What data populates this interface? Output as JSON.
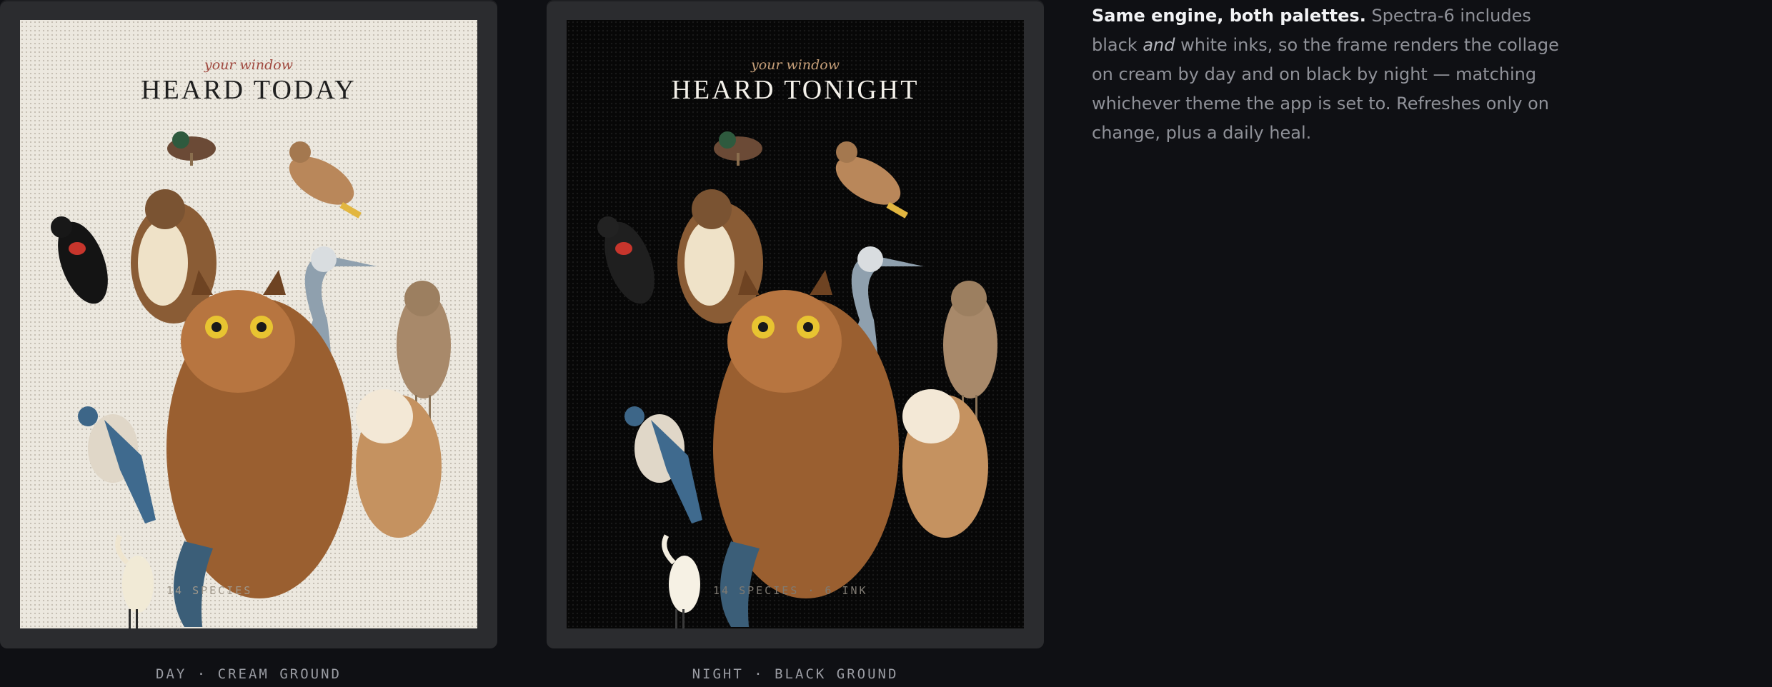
{
  "frames": [
    {
      "kicker": "your window",
      "headline": "HEARD TODAY",
      "footer": "14 SPECIES",
      "caption": "DAY · CREAM GROUND"
    },
    {
      "kicker": "your window",
      "headline": "HEARD TONIGHT",
      "footer": "14 SPECIES · 6 INK",
      "caption": "NIGHT · BLACK GROUND"
    }
  ],
  "description": {
    "lead": "Same engine, both palettes.",
    "part1": " Spectra-6 includes black ",
    "emph": "and",
    "part2": " white inks, so the frame renders the collage on cream by day and on black by night — matching whichever theme the app is set to. Refreshes only on change, plus a daily heal."
  },
  "colors": {
    "page_bg": "#0f1014",
    "frame_bg": "#2b2c2f",
    "cream_ground": "#ece8df",
    "black_ground": "#070707"
  }
}
